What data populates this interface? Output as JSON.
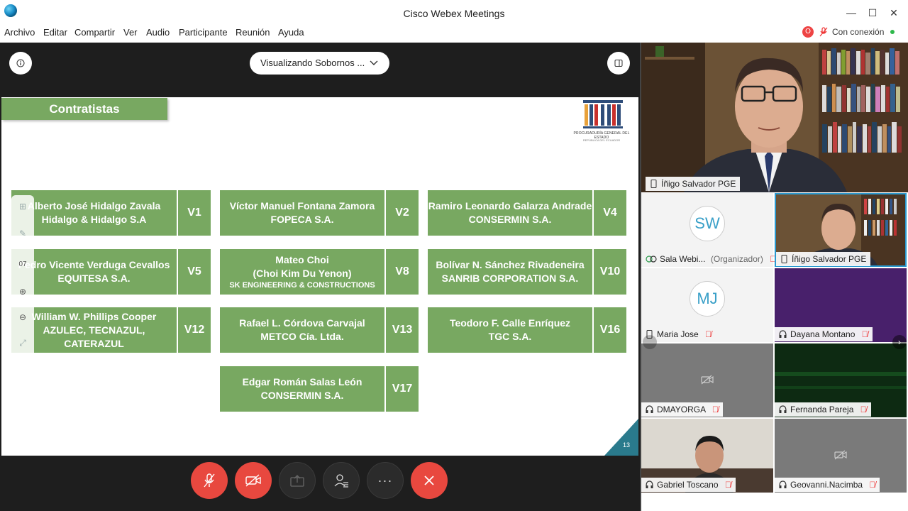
{
  "window": {
    "title": "Cisco Webex Meetings",
    "minimize": "—",
    "maximize": "☐",
    "close": "✕"
  },
  "menu": [
    "Archivo",
    "Editar",
    "Compartir",
    "Ver",
    "Audio",
    "Participante",
    "Reunión",
    "Ayuda"
  ],
  "status": {
    "recording_badge": "O",
    "connection": "Con conexión",
    "connection_color": "#2eb84b"
  },
  "share": {
    "viewing": "Visualizando Sobornos ..."
  },
  "slide": {
    "title": "Contratistas",
    "logo_caption": "PROCURADURÍA GENERAL DEL ESTADO",
    "logo_subcaption": "REPÚBLICA DEL ECUADOR",
    "page_number": "13",
    "accent_color": "#78a861",
    "cards": [
      {
        "lines": [
          "Alberto José Hidalgo Zavala",
          "Hidalgo & Hidalgo S.A"
        ],
        "code": "V1"
      },
      {
        "lines": [
          "Víctor Manuel Fontana Zamora",
          "FOPECA S.A."
        ],
        "code": "V2"
      },
      {
        "lines": [
          "Ramiro Leonardo Galarza Andrade",
          "CONSERMIN S.A."
        ],
        "code": "V4"
      },
      {
        "lines": [
          "Pedro Vicente Verduga Cevallos",
          "EQUITESA S.A."
        ],
        "code": "V5"
      },
      {
        "lines": [
          "Mateo Choi",
          "(Choi Kim Du Yenon)",
          "SK ENGINEERING & CONSTRUCTIONS"
        ],
        "code": "V8"
      },
      {
        "lines": [
          "Bolívar N. Sánchez Rivadeneira",
          "SANRIB CORPORATION S.A."
        ],
        "code": "V10"
      },
      {
        "lines": [
          "William W. Phillips Cooper",
          "AZULEC, TECNAZUL,",
          "CATERAZUL"
        ],
        "code": "V12"
      },
      {
        "lines": [
          "Rafael L. Córdova Carvajal",
          "METCO Cía. Ltda."
        ],
        "code": "V13"
      },
      {
        "lines": [
          "Teodoro F. Calle Enríquez",
          "TGC S.A."
        ],
        "code": "V16"
      },
      {
        "lines": [
          "Edgar Román Salas León",
          "CONSERMIN S.A."
        ],
        "code": "V17"
      }
    ],
    "tool_page": "07"
  },
  "controls": [
    "mute",
    "stop-video",
    "share",
    "participants",
    "more",
    "leave"
  ],
  "participants": {
    "active_speaker": "Íñigo Salvador PGE",
    "tiles": [
      {
        "name": "Sala Webi...",
        "role": "(Organizador)",
        "initials": "SW"
      },
      {
        "name": "Íñigo Salvador PGE",
        "role": ""
      },
      {
        "name": "Maria Jose",
        "role": "",
        "initials": "MJ"
      },
      {
        "name": "Dayana Montano",
        "role": ""
      },
      {
        "name": "DMAYORGA",
        "role": ""
      },
      {
        "name": "Fernanda Pareja",
        "role": ""
      },
      {
        "name": "Gabriel Toscano",
        "role": ""
      },
      {
        "name": "Geovanni.Nacimba",
        "role": ""
      }
    ]
  }
}
